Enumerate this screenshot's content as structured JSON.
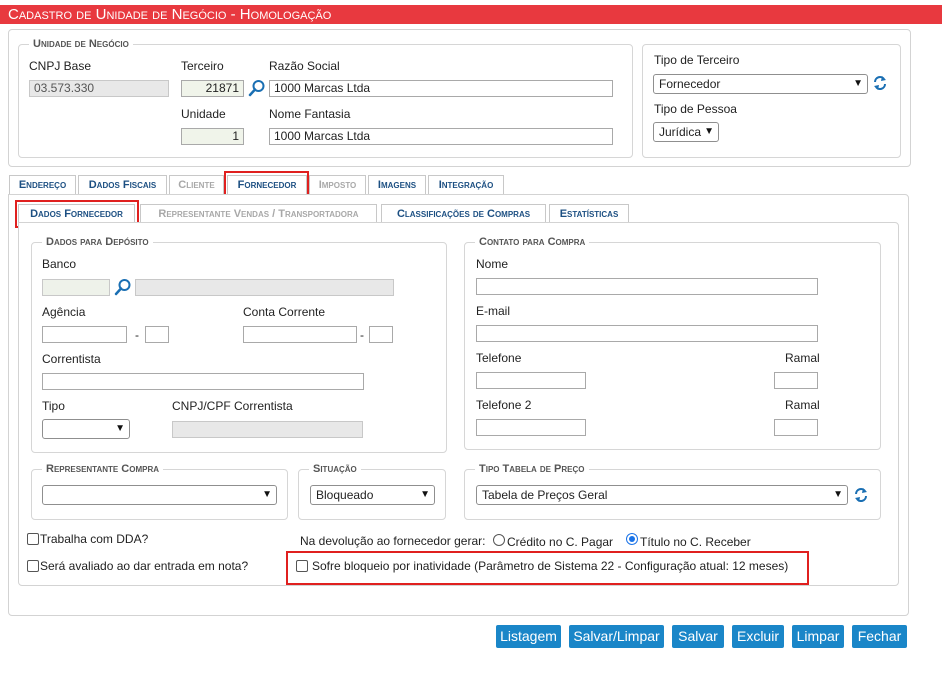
{
  "window": {
    "title": "Cadastro de Unidade de Negócio  - Homologação"
  },
  "unidade": {
    "legend": "Unidade de Negócio",
    "cnpj_label": "CNPJ Base",
    "cnpj_value": "03.573.330",
    "terceiro_label": "Terceiro",
    "terceiro_value": "21871",
    "razao_label": "Razão Social",
    "razao_value": "1000 Marcas Ltda",
    "unidade_label": "Unidade",
    "unidade_value": "1",
    "fantasia_label": "Nome Fantasia",
    "fantasia_value": "1000 Marcas Ltda"
  },
  "tipo": {
    "terceiro_label": "Tipo de Terceiro",
    "terceiro_value": "Fornecedor",
    "pessoa_label": "Tipo de Pessoa",
    "pessoa_value": "Jurídica"
  },
  "tabs": [
    {
      "label": "Endereço",
      "active": false
    },
    {
      "label": "Dados Fiscais",
      "active": false
    },
    {
      "label": "Cliente",
      "active": false
    },
    {
      "label": "Fornecedor",
      "active": true
    },
    {
      "label": "Imposto",
      "active": false
    },
    {
      "label": "Imagens",
      "active": false
    },
    {
      "label": "Integração",
      "active": false
    }
  ],
  "subtabs": [
    {
      "label": "Dados Fornecedor",
      "active": true
    },
    {
      "label": "Representante Vendas / Transportadora",
      "active": false
    },
    {
      "label": "Classificações de Compras",
      "active": false
    },
    {
      "label": "Estatísticas",
      "active": false
    }
  ],
  "deposito": {
    "legend": "Dados para Depósito",
    "banco_label": "Banco",
    "agencia_label": "Agência",
    "conta_label": "Conta Corrente",
    "dash": "-",
    "correntista_label": "Correntista",
    "tipo_label": "Tipo",
    "cnpjcpf_label": "CNPJ/CPF Correntista"
  },
  "contato": {
    "legend": "Contato para Compra",
    "nome_label": "Nome",
    "email_label": "E-mail",
    "telefone_label": "Telefone",
    "ramal_label": "Ramal",
    "telefone2_label": "Telefone 2",
    "ramal2_label": "Ramal"
  },
  "representante": {
    "legend": "Representante Compra",
    "value": ""
  },
  "situacao": {
    "legend": "Situação",
    "value": "Bloqueado"
  },
  "tabela": {
    "legend": "Tipo Tabela de Preço",
    "value": "Tabela de Preços Geral"
  },
  "options": {
    "dda_label": "Trabalha com DDA?",
    "avaliado_label": "Será avaliado ao dar entrada em nota?",
    "devolucao_label": "Na devolução ao fornecedor gerar:",
    "credito_label": "Crédito no C. Pagar",
    "titulo_label": "Título no C. Receber",
    "bloqueio_label": "Sofre bloqueio por inatividade (Parâmetro de Sistema 22 - Configuração atual: 12 meses)"
  },
  "buttons": {
    "listagem": "Listagem",
    "salvar_limpar": "Salvar/Limpar",
    "salvar": "Salvar",
    "excluir": "Excluir",
    "limpar": "Limpar",
    "fechar": "Fechar"
  },
  "colors": {
    "title_bar": "#e8393f",
    "button": "#1a86c8",
    "tab_text": "#1c4f82",
    "highlight": "#e0201f"
  }
}
